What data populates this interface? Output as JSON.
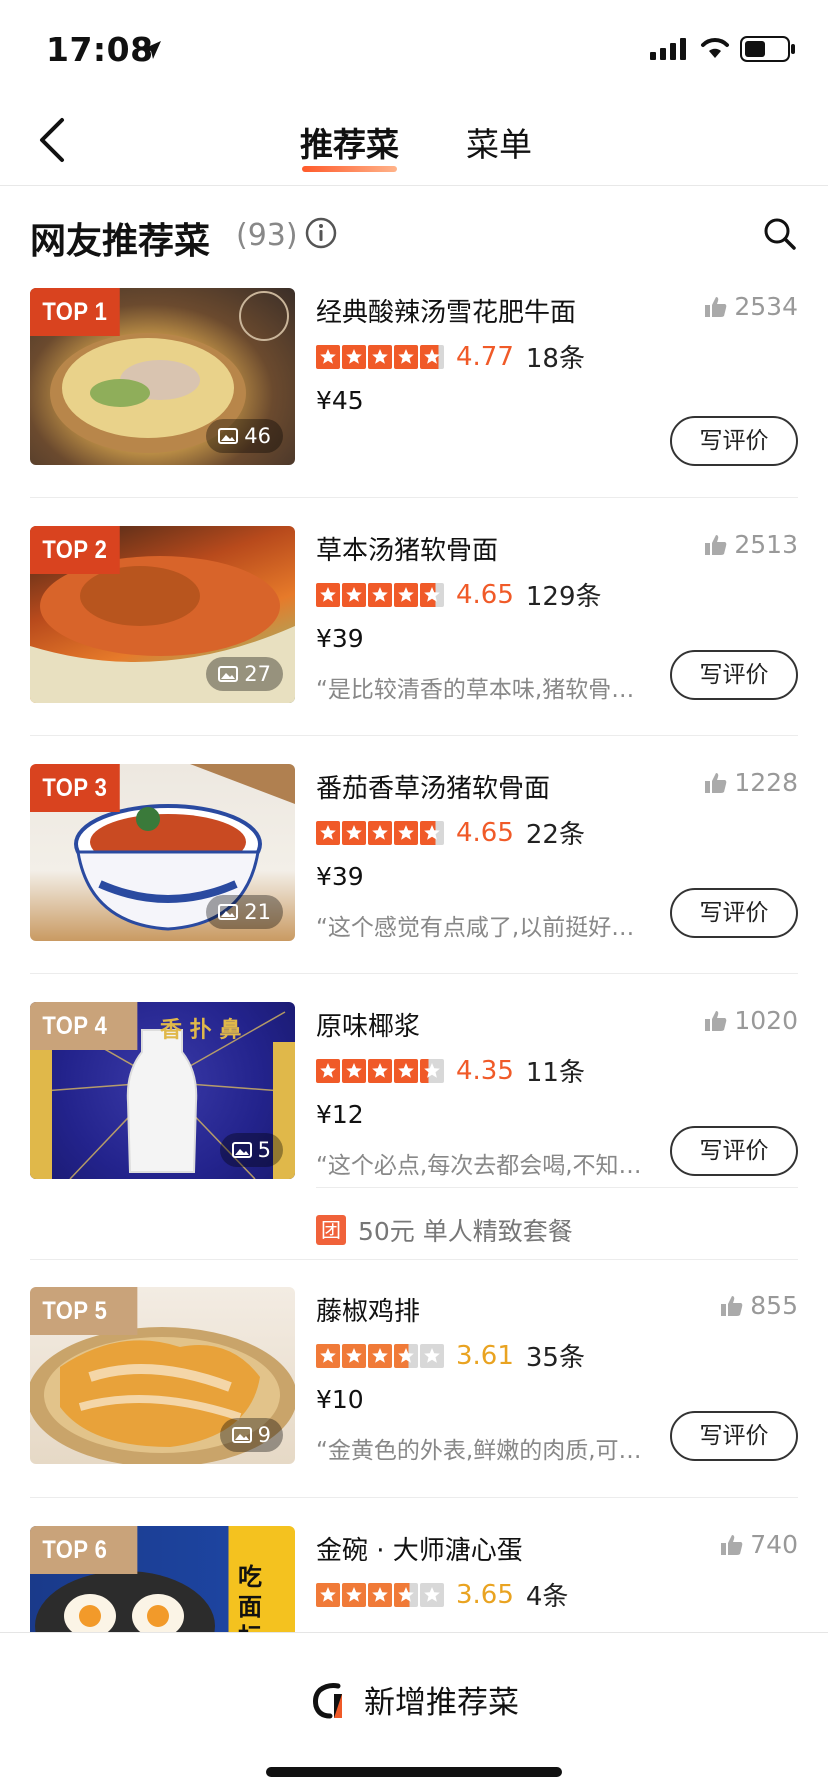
{
  "status_bar": {
    "time": "17:08"
  },
  "nav": {
    "tabs": [
      "推荐菜",
      "菜单"
    ]
  },
  "section": {
    "title": "网友推荐菜",
    "count": "(93)"
  },
  "dishes": [
    {
      "rank": "TOP 1",
      "name": "经典酸辣汤雪花肥牛面",
      "likes": "2534",
      "rating": 4.77,
      "rating_text": "4.77",
      "reviews": "18条",
      "price": "¥45",
      "quote": "",
      "images": "46",
      "button": "写评价"
    },
    {
      "rank": "TOP 2",
      "name": "草本汤猪软骨面",
      "likes": "2513",
      "rating": 4.65,
      "rating_text": "4.65",
      "reviews": "129条",
      "price": "¥39",
      "quote": "“是比较清香的草本味,猪软骨也…",
      "images": "27",
      "button": "写评价"
    },
    {
      "rank": "TOP 3",
      "name": "番茄香草汤猪软骨面",
      "likes": "1228",
      "rating": 4.65,
      "rating_text": "4.65",
      "reviews": "22条",
      "price": "¥39",
      "quote": "“这个感觉有点咸了,以前挺好吃…",
      "images": "21",
      "button": "写评价"
    },
    {
      "rank": "TOP 4",
      "name": "原味椰浆",
      "likes": "1020",
      "rating": 4.35,
      "rating_text": "4.35",
      "reviews": "11条",
      "price": "¥12",
      "quote": "“这个必点,每次去都会喝,不知道…",
      "images": "5",
      "button": "写评价",
      "thumb_text": "香 扑 鼻"
    },
    {
      "rank": "TOP 5",
      "name": "藤椒鸡排",
      "likes": "855",
      "rating": 3.61,
      "rating_text": "3.61",
      "reviews": "35条",
      "price": "¥10",
      "quote": "“金黄色的外表,鲜嫩的肉质,可以…",
      "images": "9",
      "button": "写评价"
    },
    {
      "rank": "TOP 6",
      "name": "金碗 · 大师溏心蛋",
      "likes": "740",
      "rating": 3.65,
      "rating_text": "3.65",
      "reviews": "4条",
      "price": "",
      "quote": "",
      "images": "",
      "button": "",
      "thumb_text": "吃面标配"
    }
  ],
  "combo": {
    "tag": "团",
    "text": "50元 单人精致套餐"
  },
  "bottom": {
    "add_label": "新增推荐菜"
  },
  "colors": {
    "accent": "#f05a28",
    "badge_red": "#d9431f",
    "badge_tan": "#c9a37a"
  }
}
